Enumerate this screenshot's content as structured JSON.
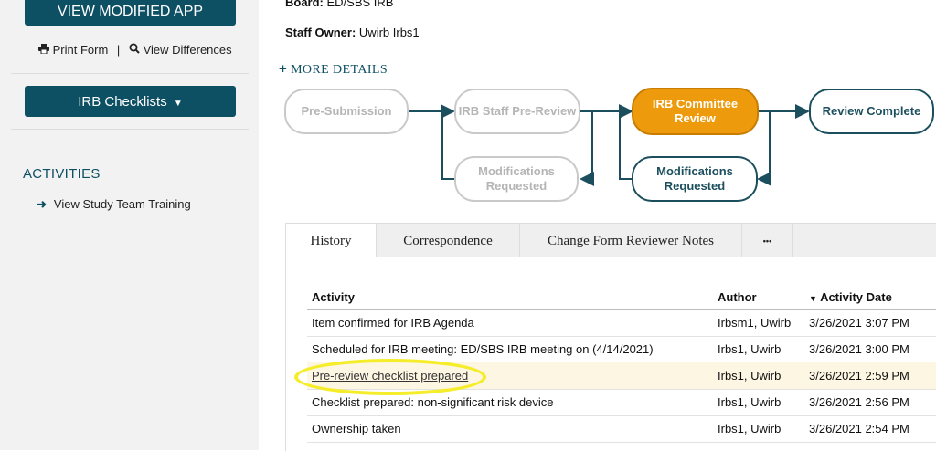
{
  "sidebar": {
    "view_modified_label": "VIEW MODIFIED APP",
    "print_form_label": "Print Form",
    "divider": "|",
    "view_differences_label": "View Differences",
    "irb_checklists_label": "IRB Checklists",
    "activities_heading": "ACTIVITIES",
    "activities": [
      {
        "label": "View Study Team Training"
      }
    ]
  },
  "header": {
    "board_label": "Board:",
    "board_value": "ED/SBS IRB",
    "staff_owner_label": "Staff Owner:",
    "staff_owner_value": "Uwirb Irbs1",
    "more_details_label": "MORE DETAILS"
  },
  "workflow": {
    "states": [
      {
        "label": "Pre-Submission",
        "status": "inactive"
      },
      {
        "label": "IRB Staff Pre-Review",
        "status": "inactive"
      },
      {
        "label": "IRB Committee Review",
        "status": "active"
      },
      {
        "label": "Review Complete",
        "status": "pending"
      },
      {
        "label": "Modifications Requested",
        "status": "inactive"
      },
      {
        "label": "Modifications Requested",
        "status": "pending"
      }
    ]
  },
  "tabs": [
    {
      "label": "History",
      "active": true
    },
    {
      "label": "Correspondence",
      "active": false
    },
    {
      "label": "Change Form Reviewer Notes",
      "active": false
    },
    {
      "label": "•••",
      "active": false
    }
  ],
  "history": {
    "columns": [
      "Activity",
      "Author",
      "Activity Date"
    ],
    "sort_indicator": "▼",
    "rows": [
      {
        "activity": "Item confirmed for IRB Agenda",
        "author": "Irbsm1, Uwirb",
        "date": "3/26/2021 3:07 PM"
      },
      {
        "activity": "Scheduled for IRB meeting: ED/SBS IRB meeting on (4/14/2021)",
        "author": "Irbs1, Uwirb",
        "date": "3/26/2021 3:00 PM"
      },
      {
        "activity": "Pre-review checklist prepared",
        "author": "Irbs1, Uwirb",
        "date": "3/26/2021 2:59 PM"
      },
      {
        "activity": "Checklist prepared: non-significant risk device",
        "author": "Irbs1, Uwirb",
        "date": "3/26/2021 2:56 PM"
      },
      {
        "activity": "Ownership taken",
        "author": "Irbs1, Uwirb",
        "date": "3/26/2021 2:54 PM"
      }
    ]
  },
  "colors": {
    "brand": "#0d4f63",
    "active_state": "#ee9a0d",
    "highlight_ring": "#f5ed2a"
  }
}
